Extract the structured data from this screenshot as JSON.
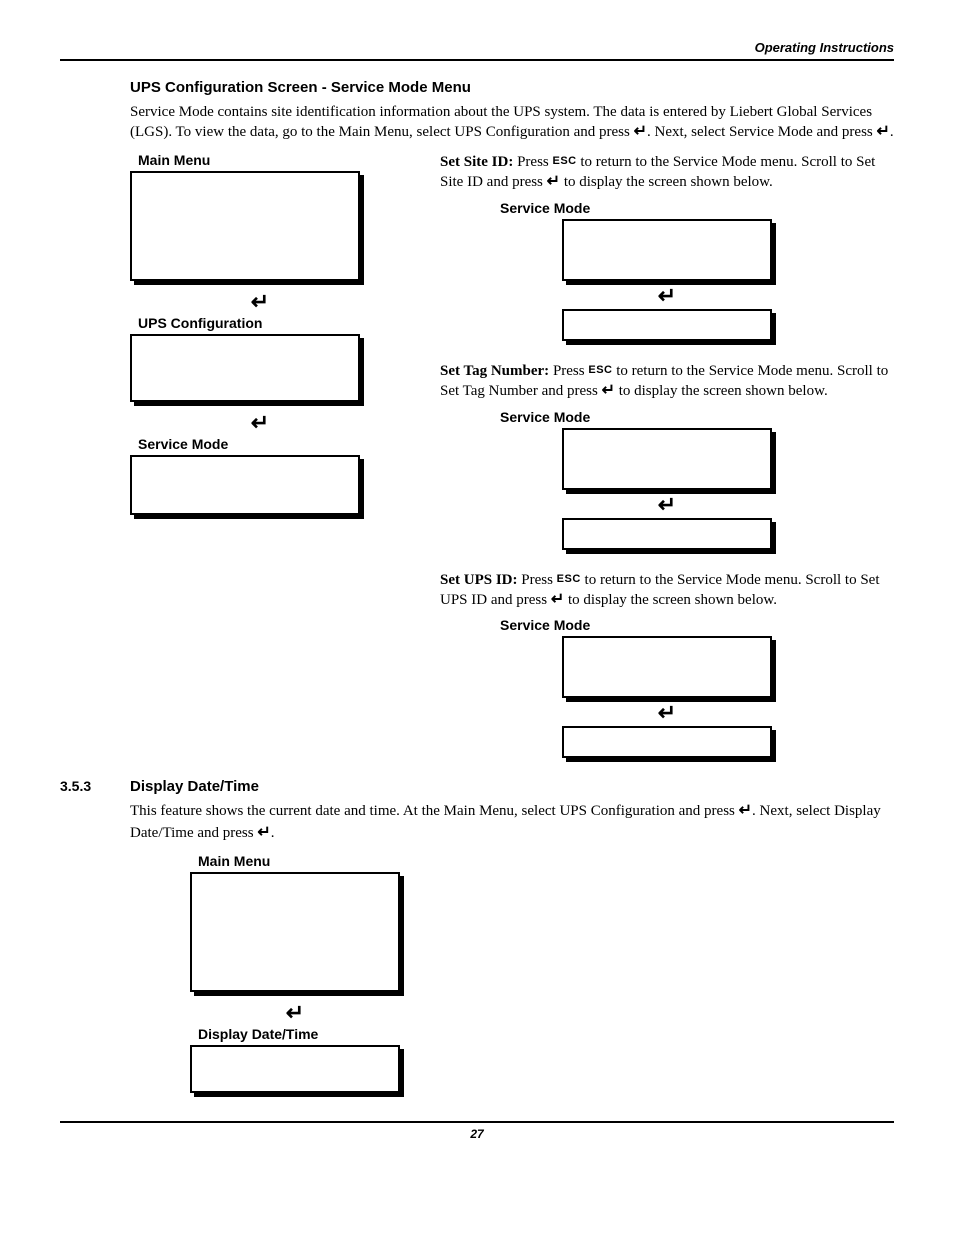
{
  "header": {
    "running": "Operating Instructions"
  },
  "glyphs": {
    "enter": "↵",
    "esc": "ESC"
  },
  "section1": {
    "title": "UPS Configuration Screen - Service Mode Menu",
    "intro_a": "Service Mode contains site identification information about the UPS system. The data is entered by Liebert Global Services (LGS). To view the data, go to the Main Menu, select UPS Configuration and press ",
    "intro_b": ". Next, select Service Mode and press ",
    "intro_c": "."
  },
  "left_labels": {
    "main_menu": "Main Menu",
    "ups_config": "UPS Configuration",
    "service_mode": "Service Mode"
  },
  "site_id": {
    "term": "Set Site ID:",
    "a": " Press ",
    "b": " to return to the Service Mode menu. Scroll to Set Site ID and press ",
    "c": " to display the screen shown below.",
    "label": "Service Mode"
  },
  "tag_num": {
    "term": "Set Tag Number:",
    "a": " Press ",
    "b": " to return to the Service Mode menu. Scroll to Set Tag Number and press ",
    "c": " to display the screen shown below.",
    "label": "Service Mode"
  },
  "ups_id": {
    "term": "Set UPS ID:",
    "a": " Press ",
    "b": " to return to the Service Mode menu. Scroll to Set UPS ID and press ",
    "c": " to display the screen shown below.",
    "label": "Service Mode"
  },
  "section2": {
    "num": "3.5.3",
    "title": "Display Date/Time",
    "intro_a": "This feature shows the current date and time. At the Main Menu, select UPS Configuration and press ",
    "intro_b": ". Next, select Display Date/Time and press ",
    "intro_c": ".",
    "main_menu_label": "Main Menu",
    "display_dt_label": "Display Date/Time"
  },
  "footer": {
    "page": "27"
  }
}
